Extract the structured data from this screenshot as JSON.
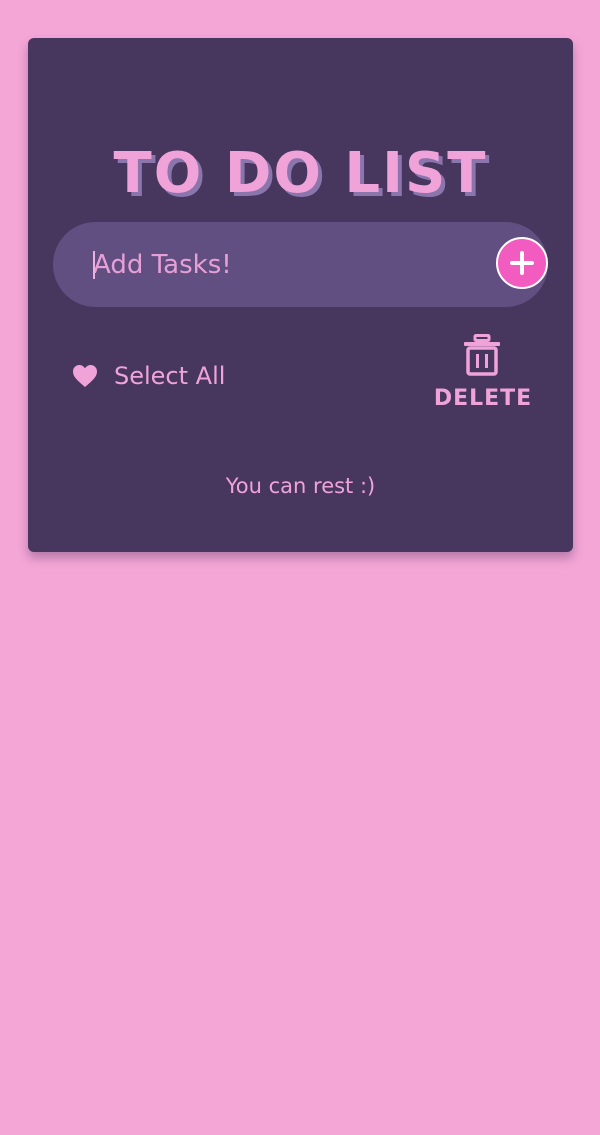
{
  "app": {
    "title": "TO DO LIST"
  },
  "input": {
    "placeholder": "Add Tasks!",
    "value": ""
  },
  "add_button": {
    "icon": "plus-icon"
  },
  "select_all": {
    "icon": "heart-icon",
    "label": "Select All"
  },
  "delete": {
    "icon": "trash-icon",
    "label": "DELETE"
  },
  "status": {
    "message": "You can rest :)"
  },
  "colors": {
    "page_background": "#f4a6d7",
    "card_background": "#47375f",
    "input_background": "#624f82",
    "accent_pink": "#f0a3d9",
    "add_button": "#f25cc0",
    "title_shadow": "#8a76ad"
  }
}
